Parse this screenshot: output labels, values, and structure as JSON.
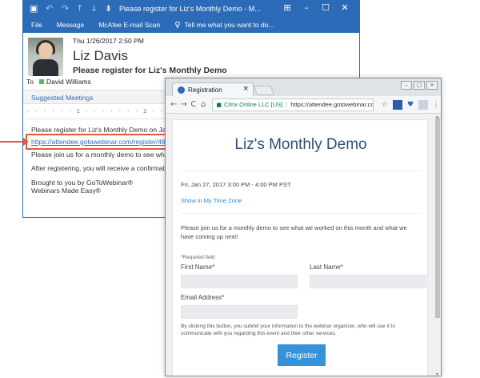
{
  "outlook": {
    "window_title": "Please register for Liz's Monthly Demo - M...",
    "ribbon_tabs": [
      "File",
      "Message",
      "McAfee E-mail Scan"
    ],
    "tell_me": "Tell me what you want to do...",
    "date": "Thu 1/26/2017 2:50 PM",
    "sender": "Liz Davis",
    "subject": "Please register for Liz's Monthly Demo",
    "to_label": "To",
    "recipient": "David Williams",
    "suggested_meetings": "Suggested Meetings",
    "ruler": "· · · · · · 1 · · · · · · · 2 · · · · · ·",
    "body": {
      "line1": "Please register for Liz's Monthly Demo on Jan 27, 2",
      "link": "https://attendee.gotowebinar.com/register/48861015",
      "line3": "Please join us for a monthly demo to see what we w",
      "line4": "After registering, you will receive a confirmation em",
      "line5a": "Brought to you by GoToWebinar®",
      "line5b": "Webinars Made Easy®"
    }
  },
  "browser": {
    "tab_title": "Registration",
    "secure_label": "Citrix Online LLC [US]",
    "url": "https://attendee.gotowebinar.com/reg",
    "page": {
      "title": "Liz's Monthly Demo",
      "datetime": "Fri, Jan 27, 2017 3:00 PM - 4:00 PM PST",
      "timezone_link": "Show in My Time Zone",
      "description": "Please join us for a monthly demo to see what we worked on this month and what we have coming up next!",
      "required_note": "*Required field",
      "first_name_label": "First Name*",
      "last_name_label": "Last Name*",
      "email_label": "Email Address*",
      "consent": "By clicking this button, you submit your information to the webinar organizer, who will use it to communicate with you regarding this event and their other services.",
      "register_button": "Register"
    }
  },
  "colors": {
    "outlook_blue": "#2b6bb7",
    "highlight": "#e05a3c",
    "register_button": "#3592d6",
    "title_navy": "#2f4f79"
  }
}
